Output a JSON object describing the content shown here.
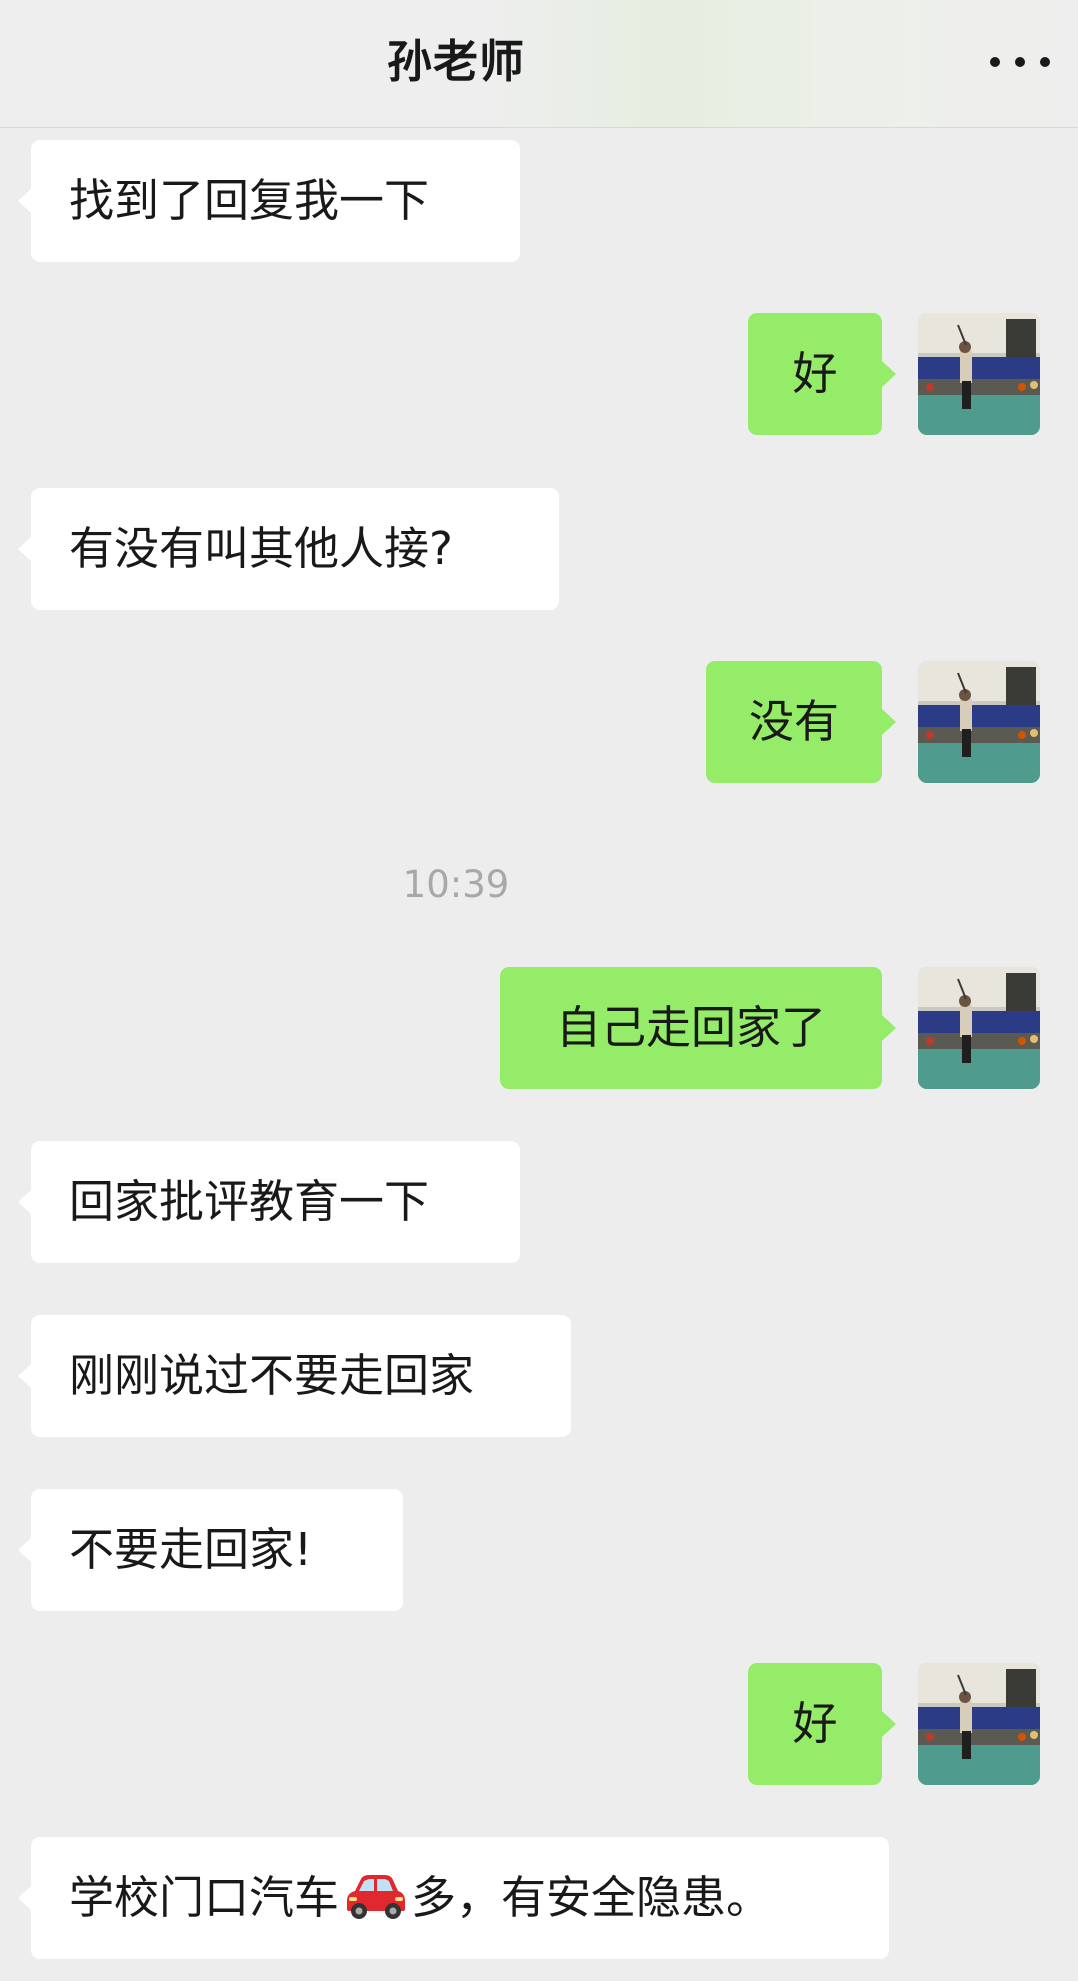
{
  "header": {
    "title": "孙老师",
    "more_icon": "more-dots-icon"
  },
  "messages": [
    {
      "side": "left",
      "text": "找到了回复我一下"
    },
    {
      "side": "right",
      "text": "好"
    },
    {
      "side": "left",
      "text": "有没有叫其他人接?"
    },
    {
      "side": "right",
      "text": "没有"
    },
    {
      "side": "right",
      "text": "自己走回家了"
    },
    {
      "side": "left",
      "text": "回家批评教育一下"
    },
    {
      "side": "left",
      "text": "刚刚说过不要走回家"
    },
    {
      "side": "left",
      "text": "不要走回家!"
    },
    {
      "side": "right",
      "text": "好"
    },
    {
      "side": "left",
      "text_before_emoji": "学校门口汽车",
      "emoji": "car-icon",
      "text_after_emoji": "多，有安全隐患。"
    }
  ],
  "timestamp": "10:39",
  "colors": {
    "background": "#ededed",
    "self_bubble": "#95ec69",
    "other_bubble": "#ffffff",
    "timestamp_text": "#a8a8a8"
  },
  "avatar_icon": "user-avatar-photo"
}
